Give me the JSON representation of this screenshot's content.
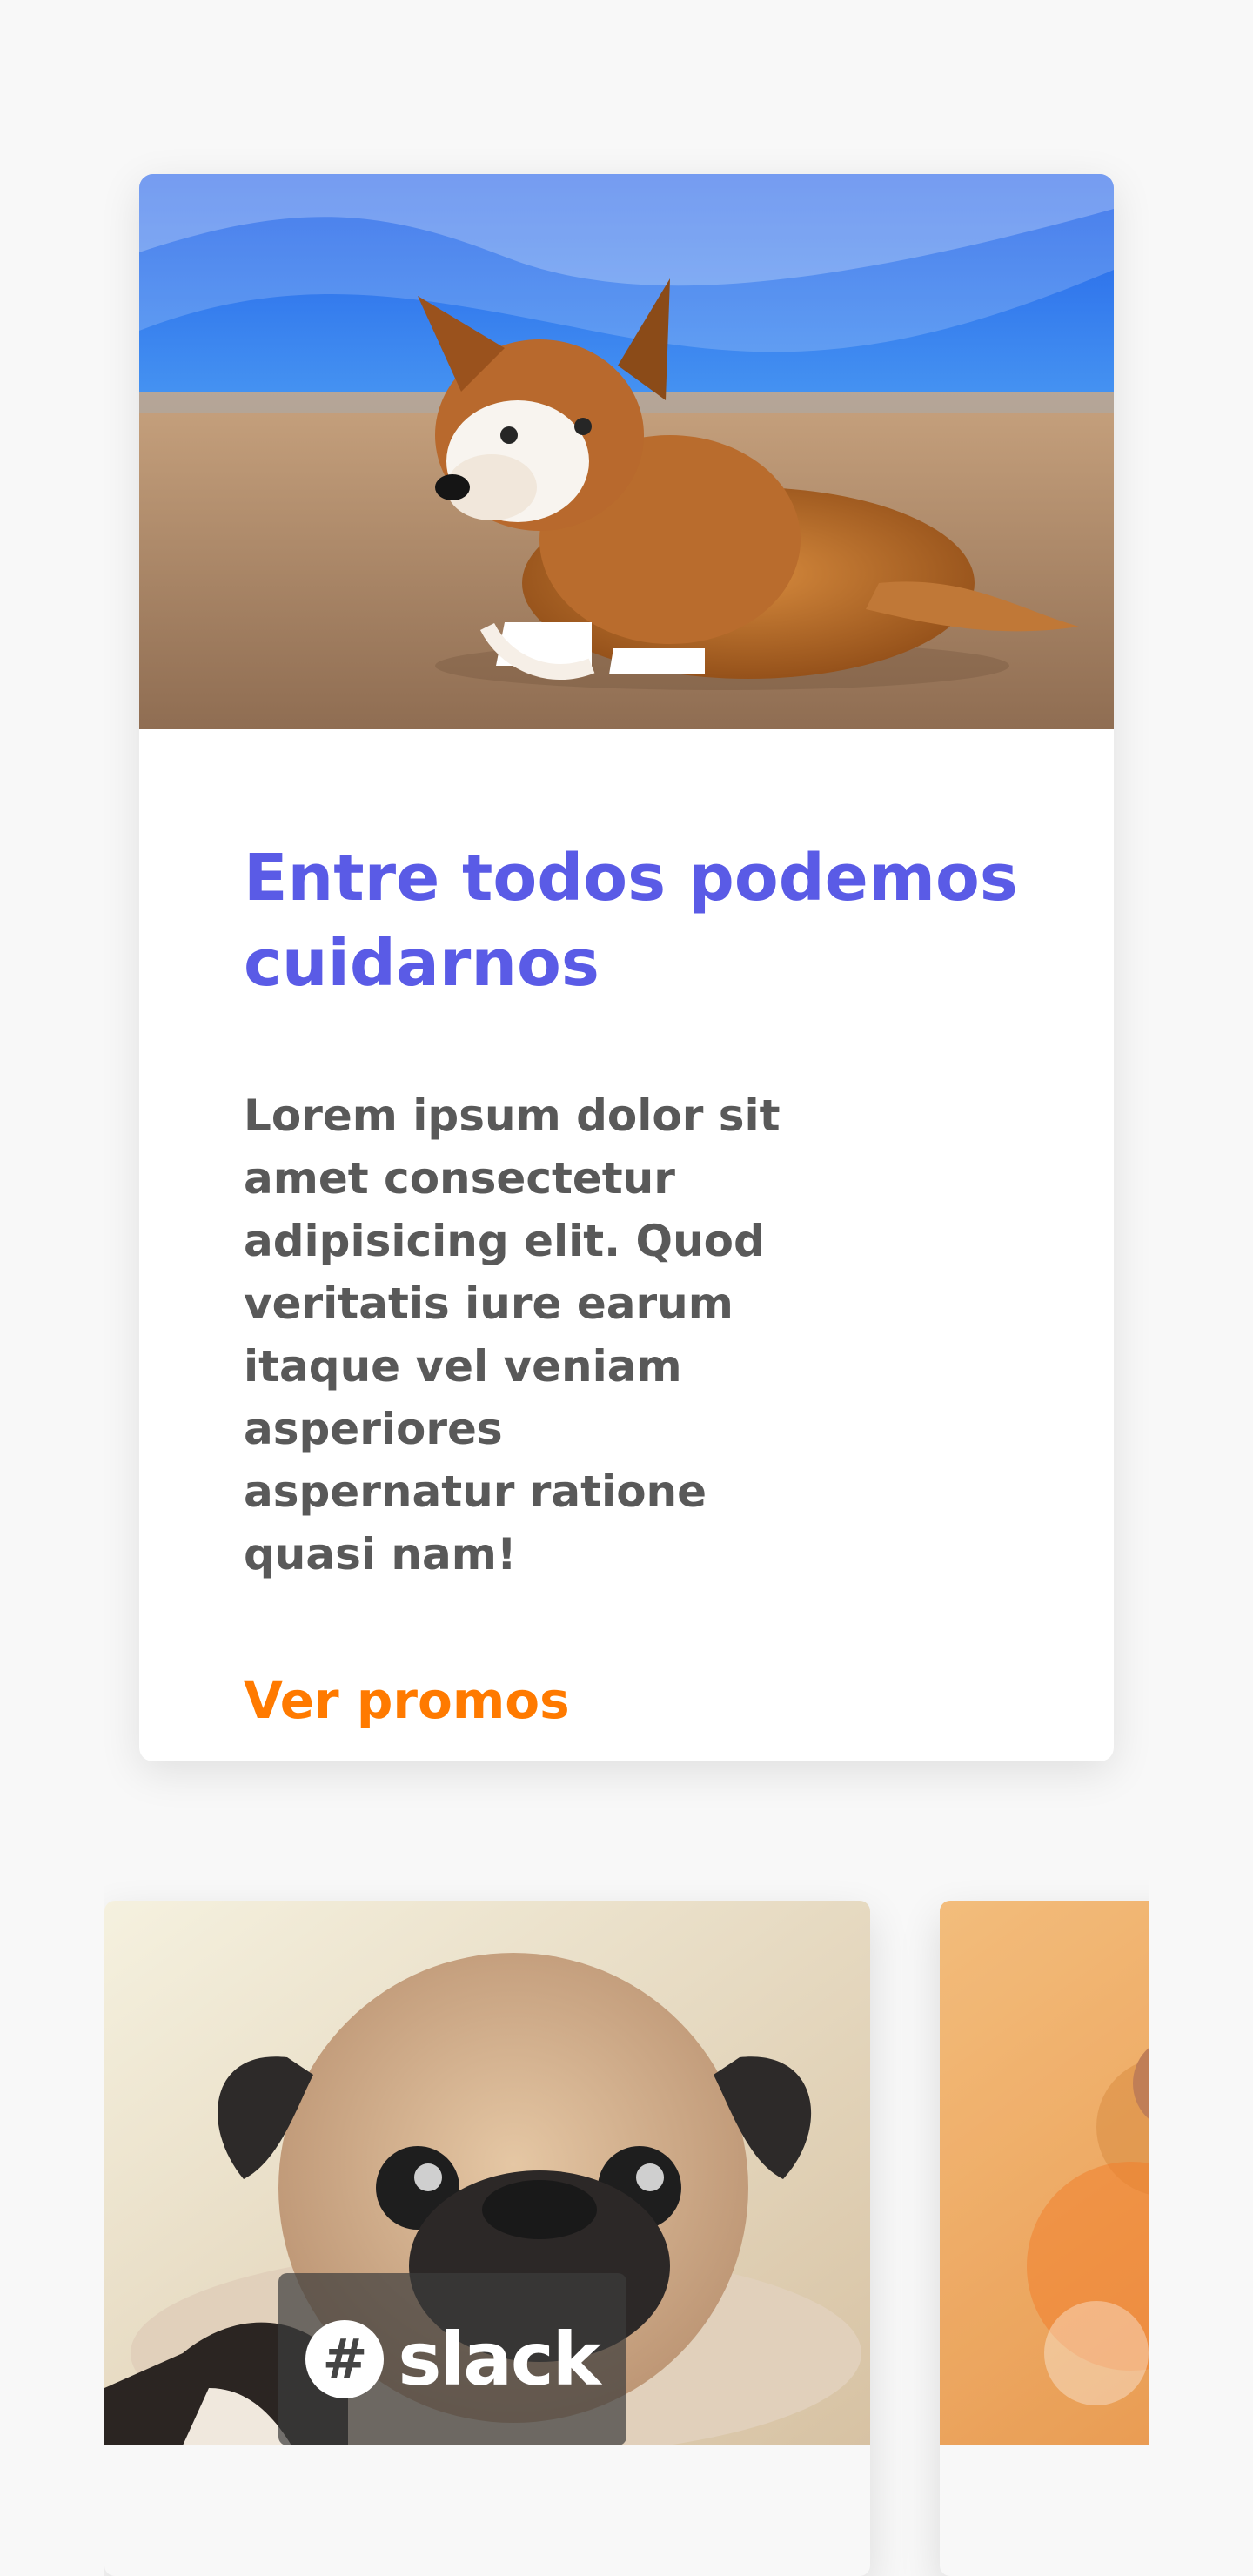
{
  "promo": {
    "title": "Entre todos podemos cuidarnos",
    "text": "Lorem ipsum dolor sit amet consectetur adipisicing elit. Quod veritatis iure earum itaque vel veniam asperiores aspernatur ratione quasi nam!",
    "link_label": "Ver promos",
    "colors": {
      "title": "#5a5be6",
      "text": "#595959",
      "link": "#ff7a00"
    }
  },
  "carousel": {
    "badge_label": "slack",
    "badge_icon": "slack-icon"
  }
}
